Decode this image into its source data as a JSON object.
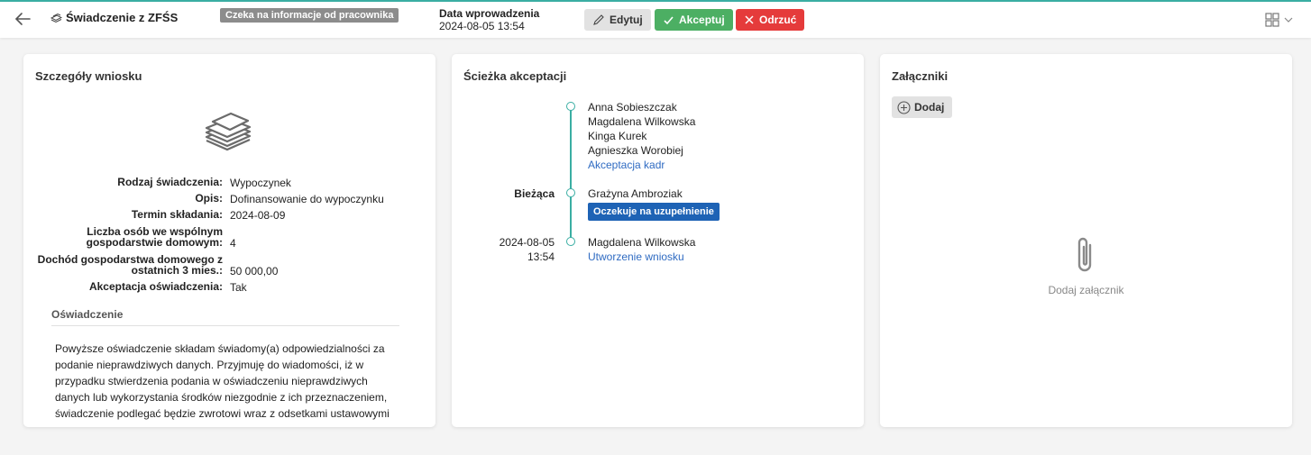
{
  "header": {
    "title": "Świadczenie z ZFŚS",
    "status": "Czeka na informacje od pracownika",
    "date_label": "Data wprowadzenia",
    "date_value": "2024-08-05 13:54",
    "edit_label": "Edytuj",
    "accept_label": "Akceptuj",
    "reject_label": "Odrzuć",
    "accent_color": "#3aaea3"
  },
  "details": {
    "title": "Szczegóły wniosku",
    "fields": [
      {
        "key": "Rodzaj świadczenia:",
        "value": "Wypoczynek"
      },
      {
        "key": "Opis:",
        "value": "Dofinansowanie do wypoczynku"
      },
      {
        "key": "Termin składania:",
        "value": "2024-08-09"
      },
      {
        "key_line1": "Liczba osób we wspólnym",
        "key_line2": "gospodarstwie domowym:",
        "value": "4"
      },
      {
        "key_line1": "Dochód gospodarstwa domowego z",
        "key_line2": "ostatnich 3 mies.:",
        "value": "50 000,00"
      },
      {
        "key": "Akceptacja oświadczenia:",
        "value": "Tak"
      }
    ],
    "statement_title": "Oświadczenie",
    "statement_text": "Powyższe oświadczenie składam świadomy(a) odpowiedzialności za podanie nieprawdziwych danych. Przyjmuję do wiadomości, iż w przypadku stwierdzenia podania w oświadczeniu nieprawdziwych danych lub wykorzystania środków niezgodnie z ich przeznaczeniem, świadczenie podlegać będzie zwrotowi wraz z odsetkami ustawowymi"
  },
  "path": {
    "title": "Ścieżka akceptacji",
    "steps": [
      {
        "people": [
          "Anna Sobieszczak",
          "Magdalena Wilkowska",
          "Kinga Kurek",
          "Agnieszka Worobiej"
        ],
        "action": "Akceptacja kadr"
      },
      {
        "left_label": "Bieżąca",
        "people": [
          "Grażyna Ambroziak"
        ],
        "badge": "Oczekuje na uzupełnienie"
      },
      {
        "left_date": "2024-08-05",
        "left_time": "13:54",
        "people": [
          "Magdalena Wilkowska"
        ],
        "action": "Utworzenie wniosku"
      }
    ]
  },
  "attachments": {
    "title": "Załączniki",
    "add_label": "Dodaj",
    "empty_label": "Dodaj załącznik"
  }
}
